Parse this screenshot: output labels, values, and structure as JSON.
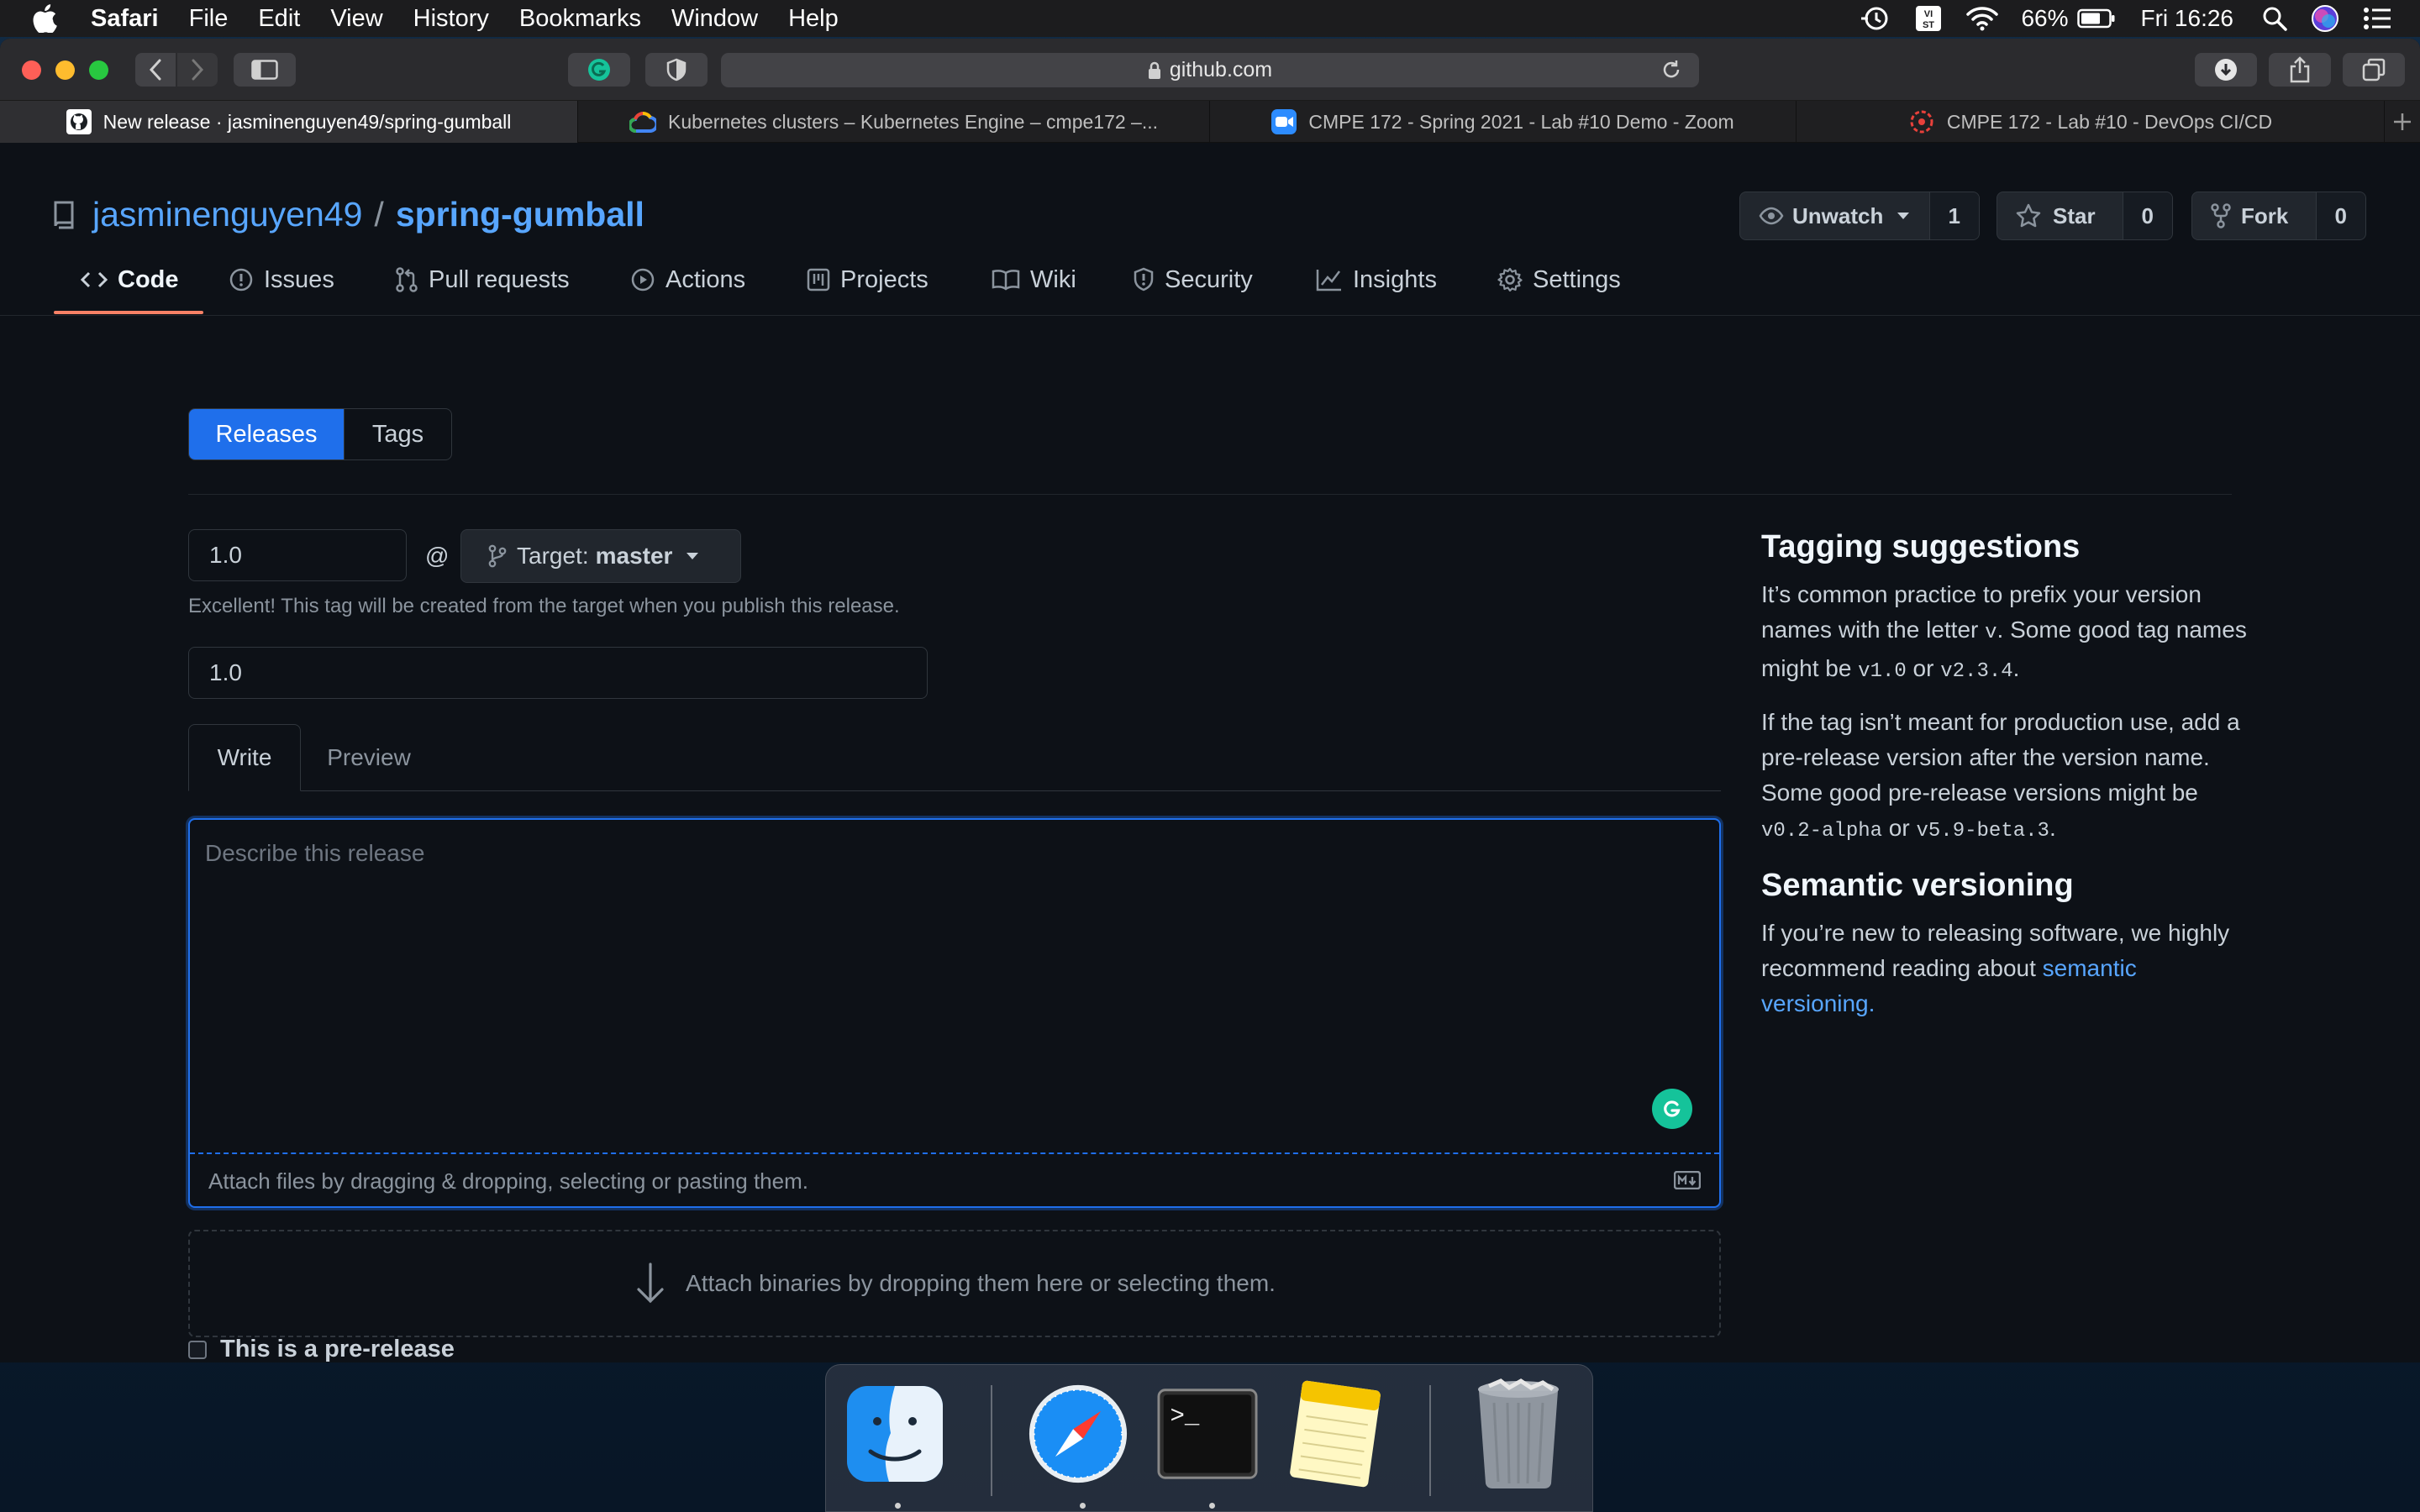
{
  "menubar": {
    "app_name": "Safari",
    "items": [
      "File",
      "Edit",
      "View",
      "History",
      "Bookmarks",
      "Window",
      "Help"
    ],
    "battery_percent": "66%",
    "clock": "Fri 16:26",
    "input_source": "VI ST"
  },
  "browser": {
    "address": "github.com",
    "tabs": [
      {
        "title": "New release · jasminenguyen49/spring-gumball",
        "icon": "github-icon",
        "active": true
      },
      {
        "title": "Kubernetes clusters – Kubernetes Engine – cmpe172 –...",
        "icon": "google-cloud-icon",
        "active": false
      },
      {
        "title": "CMPE 172 - Spring 2021 - Lab #10 Demo - Zoom",
        "icon": "zoom-icon",
        "active": false
      },
      {
        "title": "CMPE 172 - Lab #10 - DevOps CI/CD",
        "icon": "circleci-icon",
        "active": false
      }
    ]
  },
  "repo": {
    "owner": "jasminenguyen49",
    "separator": "/",
    "name": "spring-gumball",
    "unwatch_label": "Unwatch",
    "watch_count": "1",
    "star_label": "Star",
    "star_count": "0",
    "fork_label": "Fork",
    "fork_count": "0"
  },
  "nav": {
    "tabs": [
      {
        "label": "Code",
        "icon": "code-icon"
      },
      {
        "label": "Issues",
        "icon": "issue-icon"
      },
      {
        "label": "Pull requests",
        "icon": "pull-request-icon"
      },
      {
        "label": "Actions",
        "icon": "play-icon"
      },
      {
        "label": "Projects",
        "icon": "project-icon"
      },
      {
        "label": "Wiki",
        "icon": "book-icon"
      },
      {
        "label": "Security",
        "icon": "shield-icon"
      },
      {
        "label": "Insights",
        "icon": "graph-icon"
      },
      {
        "label": "Settings",
        "icon": "gear-icon"
      }
    ],
    "selected": "Code"
  },
  "release": {
    "subnav": {
      "releases": "Releases",
      "tags": "Tags"
    },
    "tag_value": "1.0",
    "at": "@",
    "target_label": "Target:",
    "target_branch": "master",
    "tag_hint": "Excellent! This tag will be created from the target when you publish this release.",
    "title_value": "1.0",
    "write_tab": "Write",
    "preview_tab": "Preview",
    "body_placeholder": "Describe this release",
    "attach_text": "Attach files by dragging & dropping, selecting or pasting them.",
    "binaries_text": "Attach binaries by dropping them here or selecting them.",
    "prerelease_label": "This is a pre-release"
  },
  "sidebar": {
    "tagging_title": "Tagging suggestions",
    "p1_a": "It’s common practice to prefix your version names with the letter ",
    "p1_code1": "v",
    "p1_b": ". Some good tag names might be ",
    "p1_code2": "v1.0",
    "p1_c": " or ",
    "p1_code3": "v2.3.4",
    "p1_d": ".",
    "p2_a": "If the tag isn’t meant for production use, add a pre-release version after the version name. Some good pre-release versions might be ",
    "p2_code1": "v0.2-alpha",
    "p2_b": " or ",
    "p2_code2": "v5.9-beta.3",
    "p2_c": ".",
    "semver_title": "Semantic versioning",
    "p3_a": "If you’re new to releasing software, we highly recommend reading about ",
    "p3_link": "semantic versioning."
  },
  "dock": {
    "apps": [
      "finder-icon",
      "safari-icon",
      "terminal-icon",
      "notes-icon",
      "trash-icon"
    ],
    "terminal_prompt": ">_"
  },
  "colors": {
    "accent_blue": "#1f6feb",
    "link_blue": "#58a6ff",
    "selected_underline": "#f78166",
    "page_bg": "#0d1117",
    "grammarly_green": "#15c39a"
  }
}
